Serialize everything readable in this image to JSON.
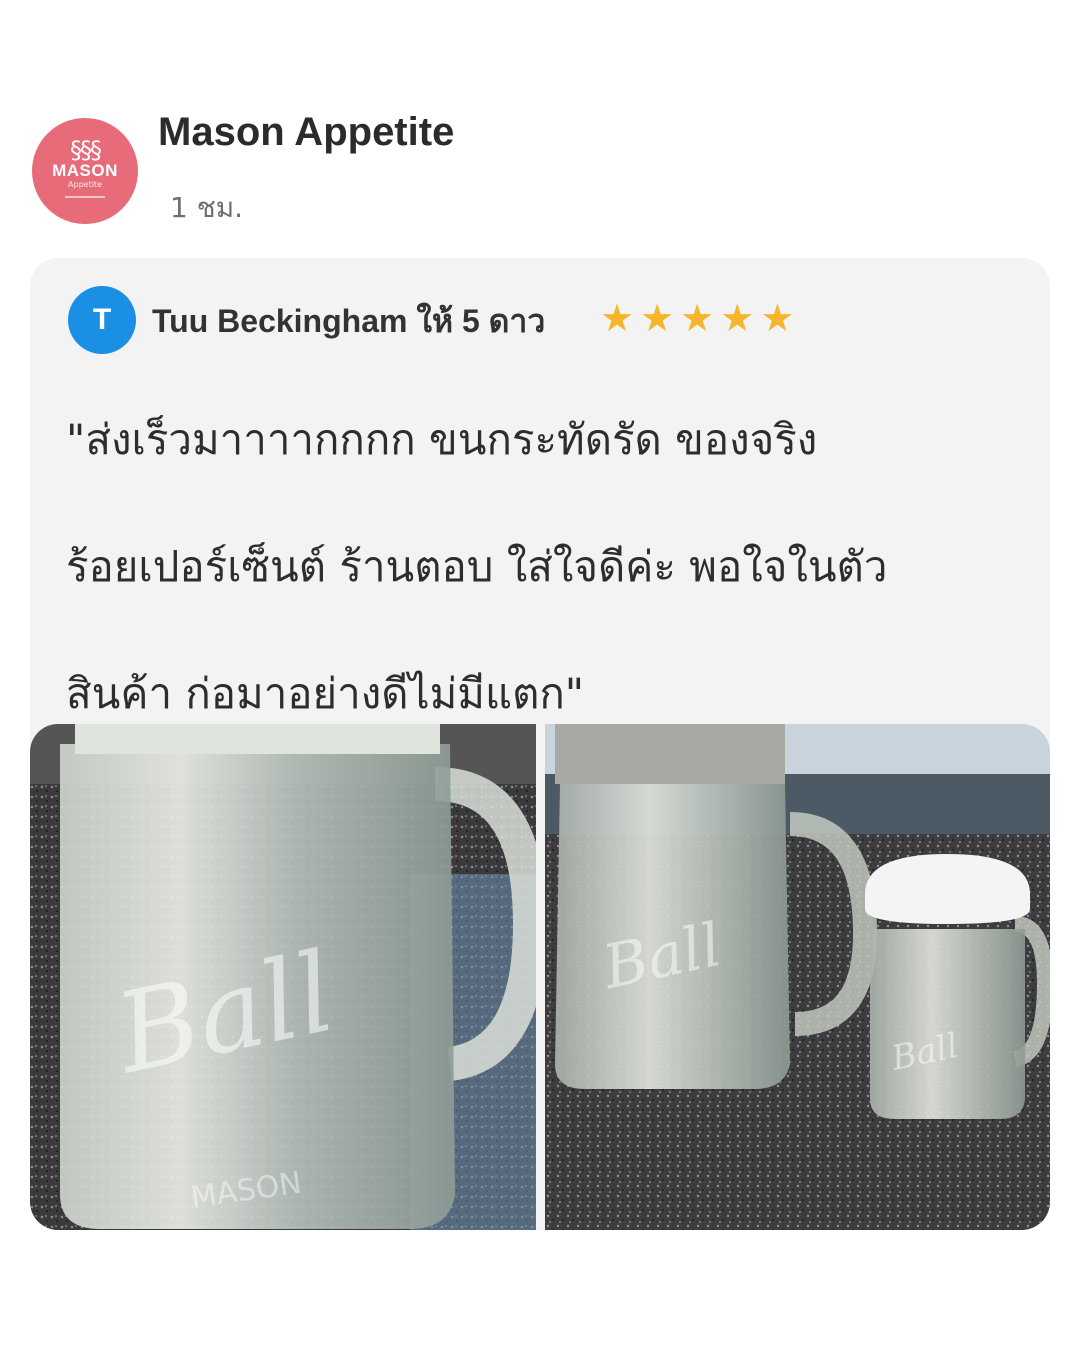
{
  "post": {
    "shop_name": "Mason Appetite",
    "time": "1 ชม.",
    "logo": {
      "word": "MASON",
      "sub": "Appetite",
      "steam": "§§§",
      "color": "#e86b7a"
    }
  },
  "review": {
    "reviewer_initial": "T",
    "reviewer_line": "Tuu Beckingham ให้ 5 ดาว",
    "rating": 5,
    "star_glyph": "★",
    "star_color": "#f6b62c",
    "avatar_color": "#1a8fe3",
    "text_lines": [
      "\"ส่งเร็วมาาาากกกก  ขนกระทัดรัด ของจริง",
      "ร้อยเปอร์เซ็นต์ ร้านตอบ ใส่ใจดีค่ะ พอใจในตัว",
      "สินค้า ก่อมาอย่างดีไม่มีแตก\""
    ]
  },
  "photos": [
    {
      "subject": "glass-mason-mug-closeup",
      "embossed_text": "Ball",
      "bottom_text": "MASON"
    },
    {
      "subject": "mason-mug-and-small-jar",
      "embossed_text": "Ball"
    }
  ]
}
